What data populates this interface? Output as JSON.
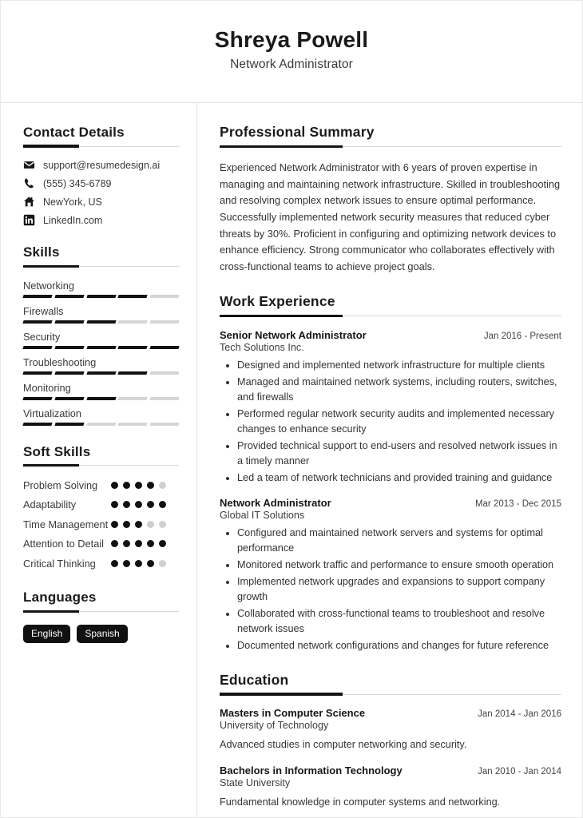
{
  "header": {
    "name": "Shreya Powell",
    "title": "Network Administrator"
  },
  "sidebar": {
    "contact": {
      "heading": "Contact Details",
      "items": [
        {
          "icon": "envelope-icon",
          "value": "support@resumedesign.ai"
        },
        {
          "icon": "phone-icon",
          "value": "(555) 345-6789"
        },
        {
          "icon": "home-icon",
          "value": "NewYork, US"
        },
        {
          "icon": "linkedin-icon",
          "value": "LinkedIn.com"
        }
      ]
    },
    "skills": {
      "heading": "Skills",
      "max": 5,
      "items": [
        {
          "name": "Networking",
          "level": 4
        },
        {
          "name": "Firewalls",
          "level": 3
        },
        {
          "name": "Security",
          "level": 5
        },
        {
          "name": "Troubleshooting",
          "level": 4
        },
        {
          "name": "Monitoring",
          "level": 3
        },
        {
          "name": "Virtualization",
          "level": 2
        }
      ]
    },
    "soft_skills": {
      "heading": "Soft Skills",
      "max": 5,
      "items": [
        {
          "name": "Problem Solving",
          "level": 4
        },
        {
          "name": "Adaptability",
          "level": 5
        },
        {
          "name": "Time Management",
          "level": 3
        },
        {
          "name": "Attention to Detail",
          "level": 5
        },
        {
          "name": "Critical Thinking",
          "level": 4
        }
      ]
    },
    "languages": {
      "heading": "Languages",
      "items": [
        "English",
        "Spanish"
      ]
    }
  },
  "main": {
    "summary": {
      "heading": "Professional Summary",
      "text": "Experienced Network Administrator with 6 years of proven expertise in managing and maintaining network infrastructure. Skilled in troubleshooting and resolving complex network issues to ensure optimal performance. Successfully implemented network security measures that reduced cyber threats by 30%. Proficient in configuring and optimizing network devices to enhance efficiency. Strong communicator who collaborates effectively with cross-functional teams to achieve project goals."
    },
    "work": {
      "heading": "Work Experience",
      "entries": [
        {
          "role": "Senior Network Administrator",
          "date": "Jan 2016 - Present",
          "org": "Tech Solutions Inc.",
          "bullets": [
            "Designed and implemented network infrastructure for multiple clients",
            "Managed and maintained network systems, including routers, switches, and firewalls",
            "Performed regular network security audits and implemented necessary changes to enhance security",
            "Provided technical support to end-users and resolved network issues in a timely manner",
            "Led a team of network technicians and provided training and guidance"
          ]
        },
        {
          "role": "Network Administrator",
          "date": "Mar 2013 - Dec 2015",
          "org": "Global IT Solutions",
          "bullets": [
            "Configured and maintained network servers and systems for optimal performance",
            "Monitored network traffic and performance to ensure smooth operation",
            "Implemented network upgrades and expansions to support company growth",
            "Collaborated with cross-functional teams to troubleshoot and resolve network issues",
            "Documented network configurations and changes for future reference"
          ]
        }
      ]
    },
    "education": {
      "heading": "Education",
      "entries": [
        {
          "degree": "Masters in Computer Science",
          "date": "Jan 2014 - Jan 2016",
          "school": "University of Technology",
          "desc": "Advanced studies in computer networking and security."
        },
        {
          "degree": "Bachelors in Information Technology",
          "date": "Jan 2010 - Jan 2014",
          "school": "State University",
          "desc": "Fundamental knowledge in computer systems and networking."
        }
      ]
    }
  }
}
